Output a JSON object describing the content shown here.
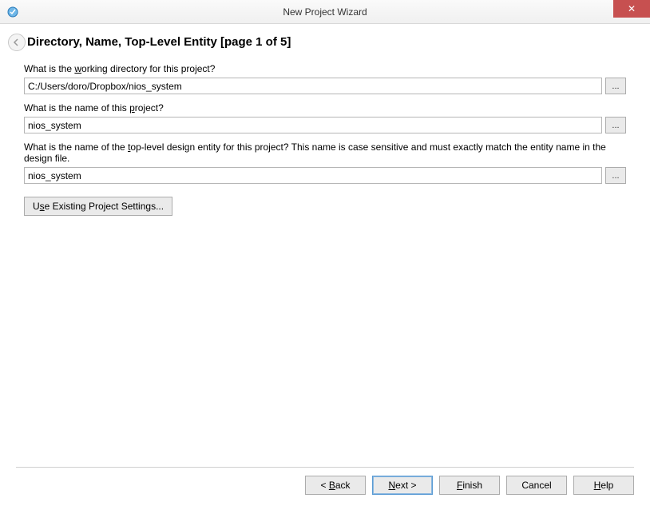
{
  "window": {
    "title": "New Project Wizard",
    "close_symbol": "✕"
  },
  "page": {
    "title": "Directory, Name, Top-Level Entity [page 1 of 5]"
  },
  "fields": {
    "working_dir": {
      "label_pre": "What is the ",
      "label_u": "w",
      "label_post": "orking directory for this project?",
      "value": "C:/Users/doro/Dropbox/nios_system",
      "browse": "..."
    },
    "project_name": {
      "label_pre": "What is the name of this ",
      "label_u": "p",
      "label_post": "roject?",
      "value": "nios_system",
      "browse": "..."
    },
    "top_entity": {
      "label_pre": "What is the name of the ",
      "label_u": "t",
      "label_post": "op-level design entity for this project? This name is case sensitive and must exactly match the entity name in the design file.",
      "value": "nios_system",
      "browse": "..."
    }
  },
  "buttons": {
    "existing_pre": "U",
    "existing_u": "s",
    "existing_post": "e Existing Project Settings...",
    "back_pre": "< ",
    "back_u": "B",
    "back_post": "ack",
    "next_pre": "",
    "next_u": "N",
    "next_post": "ext >",
    "finish_pre": "",
    "finish_u": "F",
    "finish_post": "inish",
    "cancel": "Cancel",
    "help_pre": "",
    "help_u": "H",
    "help_post": "elp"
  }
}
